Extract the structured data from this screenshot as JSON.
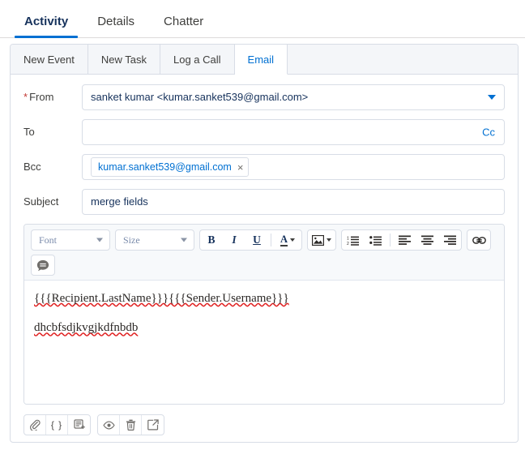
{
  "record_tabs": [
    {
      "label": "Activity",
      "active": true
    },
    {
      "label": "Details",
      "active": false
    },
    {
      "label": "Chatter",
      "active": false
    }
  ],
  "action_tabs": [
    {
      "label": "New Event",
      "active": false
    },
    {
      "label": "New Task",
      "active": false
    },
    {
      "label": "Log a Call",
      "active": false
    },
    {
      "label": "Email",
      "active": true
    }
  ],
  "form": {
    "from": {
      "label": "From",
      "required_marker": "*",
      "value": "sanket kumar <kumar.sanket539@gmail.com>",
      "placeholder": ""
    },
    "to": {
      "label": "To",
      "value": "",
      "placeholder": "",
      "cc_link": "Cc"
    },
    "bcc": {
      "label": "Bcc",
      "value": "",
      "placeholder": "",
      "pill": "kumar.sanket539@gmail.com",
      "pill_remove": "×"
    },
    "subject": {
      "label": "Subject",
      "value": "merge fields",
      "placeholder": ""
    }
  },
  "editor": {
    "font_select": "Font",
    "size_select": "Size",
    "bold_label": "B",
    "italic_label": "I",
    "underline_label": "U",
    "text_color_label": "A",
    "body_lines": [
      "{{{Recipient.LastName}}}{{{Sender.Username}}}",
      "dhcbfsdjkvgjkdfnbdb"
    ]
  },
  "colors": {
    "accent_blue": "#0070d2",
    "required_red": "#c23934",
    "border": "#d8dde6",
    "toolbar_bg": "#f7f9fb",
    "tab_bg": "#f4f6f9",
    "spellcheck_red": "#e02020"
  }
}
